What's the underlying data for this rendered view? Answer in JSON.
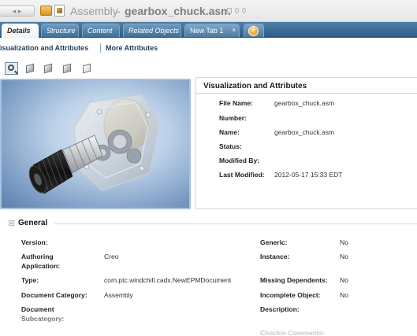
{
  "window": {
    "type_label": "Assembly",
    "separator": "-",
    "object_name": "gearbox_chuck.asm"
  },
  "tabs": [
    {
      "label": "Details",
      "active": true
    },
    {
      "label": "Structure",
      "active": false
    },
    {
      "label": "Content",
      "active": false
    },
    {
      "label": "Related Objects",
      "active": false
    },
    {
      "label": "New Tab 1",
      "active": false,
      "close": "×"
    },
    {
      "label": "+",
      "active": false
    }
  ],
  "subtabs": {
    "first": "isualization and Attributes",
    "second": "More Attributes"
  },
  "view_buttons": [
    "zoom-select-icon",
    "view-cube-icon-1",
    "view-cube-icon-2",
    "view-cube-icon-3",
    "view-cube-icon-4"
  ],
  "visualization": {
    "title": "Visualization and Attributes",
    "attributes": [
      {
        "label": "File Name:",
        "value": "gearbox_chuck.asm"
      },
      {
        "label": "Number:",
        "value": ""
      },
      {
        "label": "Name:",
        "value": "gearbox_chuck.asm"
      },
      {
        "label": "Status:",
        "value": ""
      },
      {
        "label": "Modified By:",
        "value": ""
      },
      {
        "label": "Last Modified:",
        "value": "2012-05-17 15:33 EDT"
      }
    ]
  },
  "general": {
    "title": "General",
    "left": [
      {
        "label": "Version:",
        "value": ""
      },
      {
        "label": "Authoring Application:",
        "value": "Creo"
      },
      {
        "label": "Type:",
        "value": "com.ptc.windchill.cadx.NewEPMDocument"
      },
      {
        "label": "Document Category:",
        "value": "Assembly"
      },
      {
        "label": "Document Subcategory:",
        "value": ""
      }
    ],
    "right": [
      {
        "label": "Generic:",
        "value": "No"
      },
      {
        "label": "Instance:",
        "value": "No"
      },
      {
        "label": "Missing Dependents:",
        "value": "No"
      },
      {
        "label": "Incomplete Object:",
        "value": "No"
      },
      {
        "label": "Description:",
        "value": ""
      }
    ],
    "faded_label": "Checkin Comments:"
  },
  "colors": {
    "tab_bar": "#2d5f88",
    "viewer_bg": "#7f9fc6",
    "add_tab": "#e88a12"
  }
}
